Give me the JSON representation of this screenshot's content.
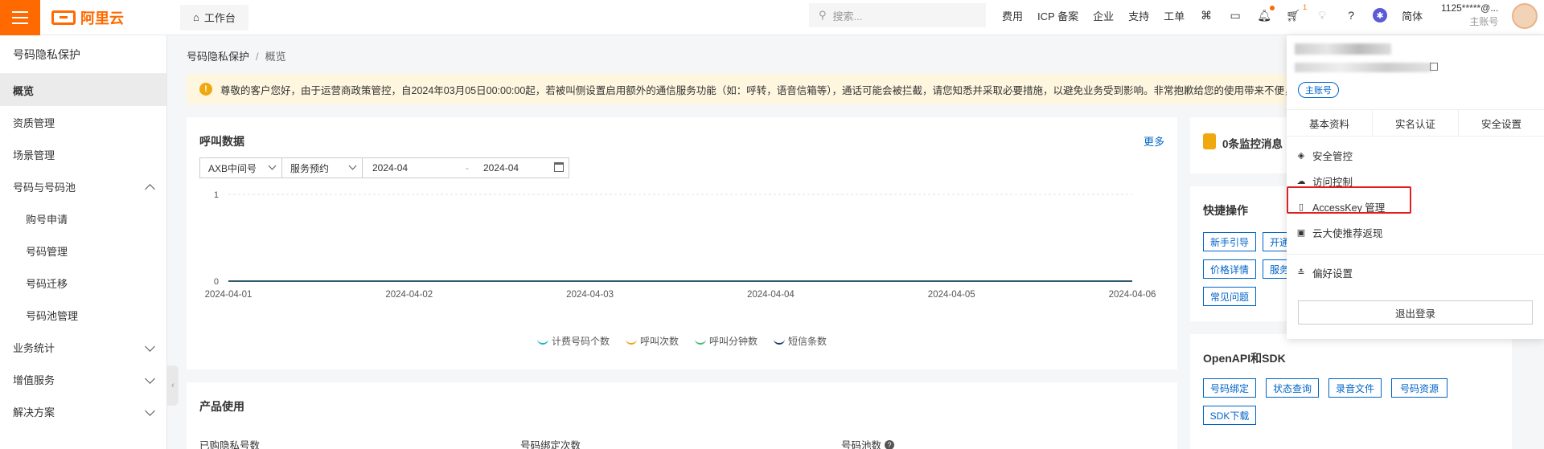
{
  "topbar": {
    "logo_text": "阿里云",
    "workbench": "工作台",
    "search_placeholder": "搜索...",
    "links": [
      "费用",
      "ICP 备案",
      "企业",
      "支持",
      "工单"
    ],
    "cart_badge": "1",
    "lang": "简体",
    "user_id": "1125*****@...",
    "user_role": "主账号"
  },
  "sidebar": {
    "title": "号码隐私保护",
    "items": [
      {
        "label": "概览",
        "active": true
      },
      {
        "label": "资质管理"
      },
      {
        "label": "场景管理"
      },
      {
        "label": "号码与号码池",
        "expanded": true
      },
      {
        "label": "购号申请",
        "sub": true
      },
      {
        "label": "号码管理",
        "sub": true
      },
      {
        "label": "号码迁移",
        "sub": true
      },
      {
        "label": "号码池管理",
        "sub": true
      },
      {
        "label": "业务统计"
      },
      {
        "label": "增值服务"
      },
      {
        "label": "解决方案"
      }
    ]
  },
  "breadcrumb": {
    "root": "号码隐私保护",
    "sep": "/",
    "current": "概览"
  },
  "notice": "尊敬的客户您好，由于运营商政策管控，自2024年03月05日00:00:00起，若被叫侧设置启用额外的通信服务功能（如：呼转，语音信箱等），通话可能会被拦截，请您知悉并采取必要措施，以避免业务受到影响。非常抱歉给您的使用带来不便，敬请谅解。",
  "call_data": {
    "title": "呼叫数据",
    "more": "更多",
    "filter_type": "AXB中间号",
    "filter_service": "服务预约",
    "date_start": "2024-04",
    "date_sep": "-",
    "date_end": "2024-04"
  },
  "chart_data": {
    "type": "line",
    "x": [
      "2024-04-01",
      "2024-04-02",
      "2024-04-03",
      "2024-04-04",
      "2024-04-05",
      "2024-04-06"
    ],
    "series": [
      {
        "name": "计费号码个数",
        "values": [
          0,
          0,
          0,
          0,
          0,
          0
        ],
        "color": "#1bb5c8"
      },
      {
        "name": "呼叫次数",
        "values": [
          0,
          0,
          0,
          0,
          0,
          0
        ],
        "color": "#f0a020"
      },
      {
        "name": "呼叫分钟数",
        "values": [
          0,
          0,
          0,
          0,
          0,
          0
        ],
        "color": "#3cb878"
      },
      {
        "name": "短信条数",
        "values": [
          0,
          0,
          0,
          0,
          0,
          0
        ],
        "color": "#1a3a6b"
      }
    ],
    "yticks": [
      "1",
      "0"
    ],
    "ylim": [
      0,
      1
    ],
    "grid": true,
    "legend_position": "bottom"
  },
  "monitor": {
    "title": "0条监控消息"
  },
  "quick_ops": {
    "title": "快捷操作",
    "buttons": [
      "新手引导",
      "开通",
      "价格详情",
      "服务",
      "常见问题"
    ]
  },
  "openapi": {
    "title": "OpenAPI和SDK",
    "buttons": [
      "号码绑定",
      "状态查询",
      "录音文件",
      "号码资源",
      "SDK下载"
    ]
  },
  "product_usage": {
    "title": "产品使用",
    "cols": [
      "已购隐私号数",
      "号码绑定次数",
      "号码池数"
    ]
  },
  "dropdown": {
    "account_tag": "主账号",
    "tabs": [
      "基本资料",
      "实名认证",
      "安全设置"
    ],
    "items": [
      "安全管控",
      "访问控制",
      "AccessKey 管理",
      "云大使推荐返现",
      "偏好设置"
    ],
    "logout": "退出登录"
  }
}
